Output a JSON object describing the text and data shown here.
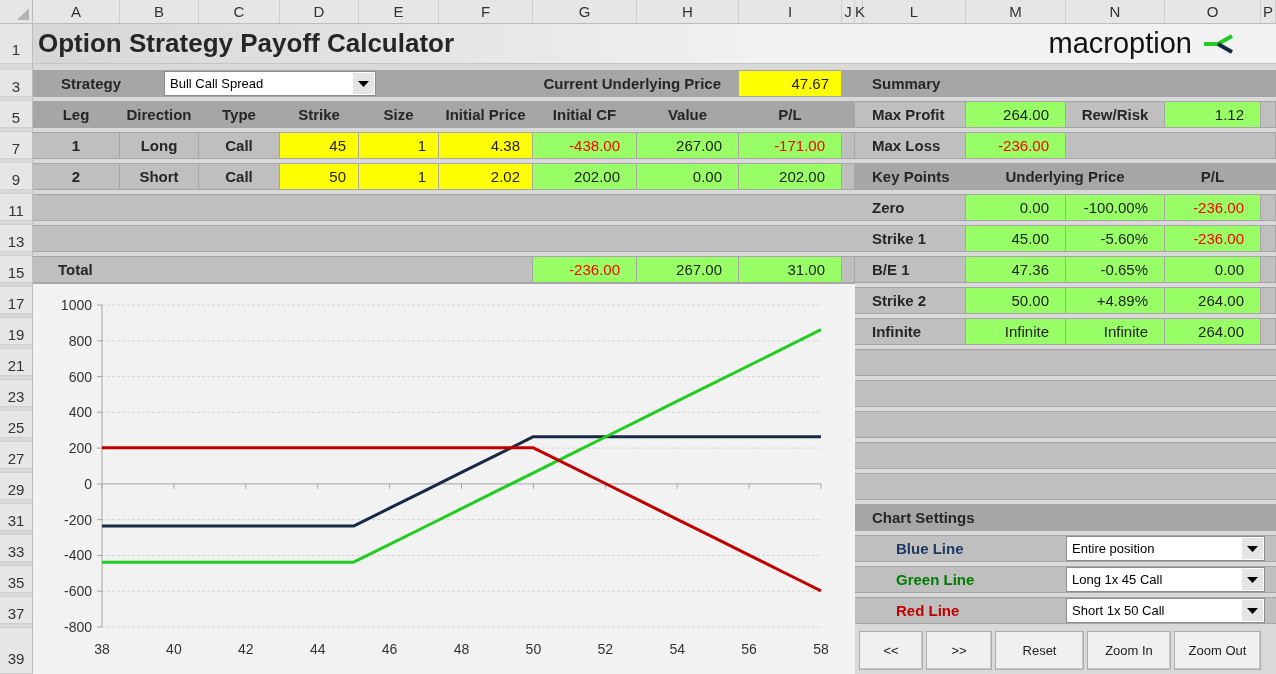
{
  "column_letters": [
    "A",
    "B",
    "C",
    "D",
    "E",
    "F",
    "G",
    "H",
    "I",
    "J",
    "K",
    "L",
    "M",
    "N",
    "O",
    "P"
  ],
  "row_numbers": [
    "1",
    "3",
    "5",
    "7",
    "9",
    "11",
    "13",
    "15",
    "17",
    "19",
    "21",
    "23",
    "25",
    "27",
    "29",
    "31",
    "33",
    "35",
    "37",
    "39"
  ],
  "title": "Option Strategy Payoff Calculator",
  "logo": {
    "text": "macroption"
  },
  "strategy": {
    "label": "Strategy",
    "value": "Bull Call Spread"
  },
  "underlying": {
    "label": "Current Underlying Price",
    "value": "47.67"
  },
  "legs_table": {
    "columns": [
      "Leg",
      "Direction",
      "Type",
      "Strike",
      "Size",
      "Initial Price",
      "Initial CF",
      "Value",
      "P/L"
    ],
    "rows": [
      {
        "leg": "1",
        "direction": "Long",
        "type": "Call",
        "strike": "45",
        "size": "1",
        "initial_price": "4.38",
        "initial_cf": {
          "text": "-438.00",
          "negative": true
        },
        "value": {
          "text": "267.00",
          "negative": false
        },
        "pl": {
          "text": "-171.00",
          "negative": true
        }
      },
      {
        "leg": "2",
        "direction": "Short",
        "type": "Call",
        "strike": "50",
        "size": "1",
        "initial_price": "2.02",
        "initial_cf": {
          "text": "202.00",
          "negative": false
        },
        "value": {
          "text": "0.00",
          "negative": false
        },
        "pl": {
          "text": "202.00",
          "negative": false
        }
      }
    ]
  },
  "total": {
    "label": "Total",
    "initial_cf": {
      "text": "-236.00",
      "negative": true
    },
    "value": {
      "text": "267.00",
      "negative": false
    },
    "pl": {
      "text": "31.00",
      "negative": false
    }
  },
  "summary": {
    "title": "Summary",
    "max_profit": {
      "label": "Max Profit",
      "value": {
        "text": "264.00",
        "negative": false
      }
    },
    "rew_risk": {
      "label": "Rew/Risk",
      "value": {
        "text": "1.12",
        "negative": false
      }
    },
    "max_loss": {
      "label": "Max Loss",
      "value": {
        "text": "-236.00",
        "negative": true
      }
    }
  },
  "key_points": {
    "columns": [
      "Key Points",
      "Underlying Price",
      "P/L"
    ],
    "rows": [
      {
        "label": "Zero",
        "price": "0.00",
        "change": "-100.00%",
        "pl": {
          "text": "-236.00",
          "negative": true
        }
      },
      {
        "label": "Strike 1",
        "price": "45.00",
        "change": "-5.60%",
        "pl": {
          "text": "-236.00",
          "negative": true
        }
      },
      {
        "label": "B/E 1",
        "price": "47.36",
        "change": "-0.65%",
        "pl": {
          "text": "0.00",
          "negative": false
        }
      },
      {
        "label": "Strike 2",
        "price": "50.00",
        "change": "+4.89%",
        "pl": {
          "text": "264.00",
          "negative": false
        }
      },
      {
        "label": "Infinite",
        "price": "Infinite",
        "change": "Infinite",
        "pl": {
          "text": "264.00",
          "negative": false
        }
      }
    ]
  },
  "chart_settings": {
    "title": "Chart Settings",
    "lines": [
      {
        "label": "Blue Line",
        "color": "#1f3864",
        "value": "Entire position"
      },
      {
        "label": "Green Line",
        "color": "#007a00",
        "value": "Long 1x 45 Call"
      },
      {
        "label": "Red Line",
        "color": "#c00000",
        "value": "Short 1x 50 Call"
      }
    ]
  },
  "buttons": [
    "<<",
    ">>",
    "Reset",
    "Zoom In",
    "Zoom Out"
  ],
  "chart": {
    "chart_data": {
      "type": "line",
      "x": [
        38,
        39,
        40,
        41,
        42,
        43,
        44,
        45,
        46,
        47,
        48,
        49,
        50,
        51,
        52,
        53,
        54,
        55,
        56,
        57,
        58
      ],
      "series": [
        {
          "color": "#172a45",
          "values": [
            -236,
            -236,
            -236,
            -236,
            -236,
            -236,
            -236,
            -236,
            -136,
            -36,
            64,
            164,
            264,
            264,
            264,
            264,
            264,
            264,
            264,
            264,
            264
          ]
        },
        {
          "color": "#22cc22",
          "values": [
            -438,
            -438,
            -438,
            -438,
            -438,
            -438,
            -438,
            -438,
            -338,
            -238,
            -138,
            -38,
            62,
            162,
            262,
            362,
            462,
            562,
            662,
            762,
            862
          ]
        },
        {
          "color": "#c00000",
          "values": [
            202,
            202,
            202,
            202,
            202,
            202,
            202,
            202,
            202,
            202,
            202,
            202,
            202,
            102,
            2,
            -98,
            -198,
            -298,
            -398,
            -498,
            -598
          ]
        }
      ],
      "grid": true,
      "xlim": [
        38,
        58
      ],
      "ylim": [
        -800,
        1000
      ],
      "xticks": [
        38,
        40,
        42,
        44,
        46,
        48,
        50,
        52,
        54,
        56,
        58
      ],
      "yticks": [
        -800,
        -600,
        -400,
        -200,
        0,
        200,
        400,
        600,
        800,
        1000
      ]
    }
  }
}
